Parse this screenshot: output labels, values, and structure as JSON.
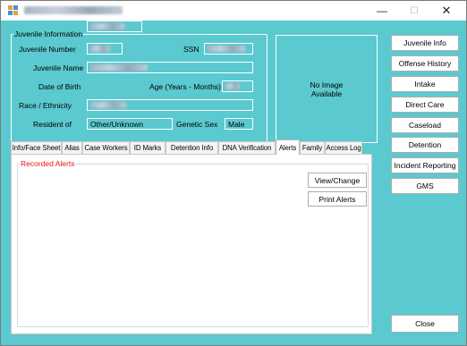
{
  "window": {
    "min_glyph": "—",
    "max_glyph": "☐",
    "close_glyph": "✕"
  },
  "info": {
    "legend": "Juvenile Information",
    "juvenile_number_label": "Juvenile Number",
    "ssn_label": "SSN",
    "juvenile_name_label": "Juvenile Name",
    "dob_label": "Date of Birth",
    "age_label": "Age (Years - Months)",
    "race_label": "Race / Ethnicity",
    "resident_label": "Resident of",
    "resident_value": "Other/Unknown",
    "genetic_sex_label": "Genetic Sex",
    "genetic_sex_value": "Male"
  },
  "photo": {
    "line1": "No Image",
    "line2": "Available"
  },
  "sidebar": {
    "buttons": [
      "Juvenile Info",
      "Offense History",
      "Intake",
      "Direct Care",
      "Caseload",
      "Detention",
      "Incident Reporting",
      "GMS"
    ],
    "close": "Close"
  },
  "tabs": [
    "Info/Face Sheet",
    "Alias",
    "Case Workers",
    "ID Marks",
    "Detention Info",
    "DNA Verification",
    "Alerts",
    "Family",
    "Access Log"
  ],
  "active_tab": "Alerts",
  "alerts_panel": {
    "legend": "Recorded Alerts",
    "view_change": "View/Change",
    "print_alerts": "Print Alerts"
  },
  "colors": {
    "form_background": "#5bc9d0",
    "alerts_legend": "#ee1111"
  }
}
